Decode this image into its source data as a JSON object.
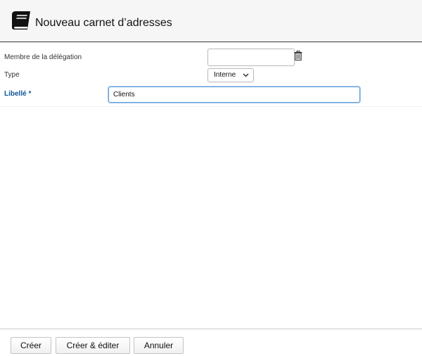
{
  "header": {
    "title": "Nouveau carnet d’adresses",
    "icon": "address-book-icon"
  },
  "form": {
    "delegation": {
      "label": "Membre de la délégation",
      "value": "",
      "clear_icon": "trash-icon"
    },
    "type": {
      "label": "Type",
      "selected": "Interne"
    },
    "libelle": {
      "label": "Libellé *",
      "value": "Clients"
    }
  },
  "footer": {
    "create_label": "Créer",
    "create_edit_label": "Créer & éditer",
    "cancel_label": "Annuler"
  },
  "colors": {
    "required_label": "#0b5595",
    "focus_border": "#5e9ed6",
    "header_bg": "#f6f6f6"
  }
}
